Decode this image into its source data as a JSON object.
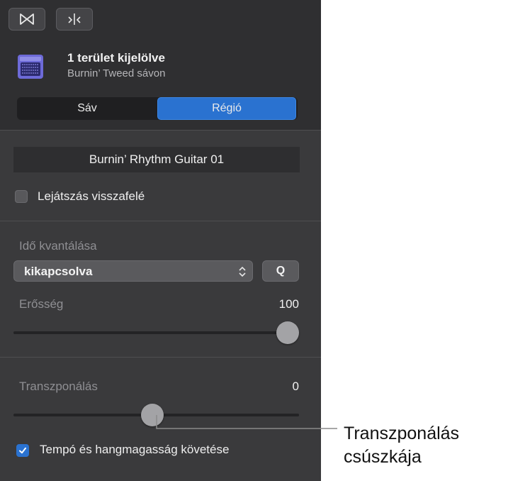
{
  "toolbar": {
    "left_icon": "loop-icon",
    "right_icon": "split-icon"
  },
  "header": {
    "icon": "amplifier-icon",
    "title": "1 terület kijelölve",
    "subtitle": "Burnin’ Tweed sávon"
  },
  "tabs": [
    {
      "label": "Sáv",
      "active": false
    },
    {
      "label": "Régió",
      "active": true
    }
  ],
  "region_name": "Burnin’ Rhythm Guitar 01",
  "reverse_playback": {
    "label": "Lejátszás visszafelé",
    "checked": false
  },
  "quantize": {
    "label": "Idő kvantálása",
    "selected": "kikapcsolva",
    "q_button": "Q"
  },
  "strength": {
    "label": "Erősség",
    "value": "100",
    "level": 1.0
  },
  "transpose": {
    "label": "Transzponálás",
    "value": "0",
    "level": 0.5
  },
  "follow_tempo": {
    "label": "Tempó és hangmagasság követése",
    "checked": true
  },
  "callout": {
    "line1": "Transzponálás",
    "line2": "csúszkája"
  },
  "colors": {
    "accent": "#2a72d0",
    "panel": "#3a3a3c"
  }
}
